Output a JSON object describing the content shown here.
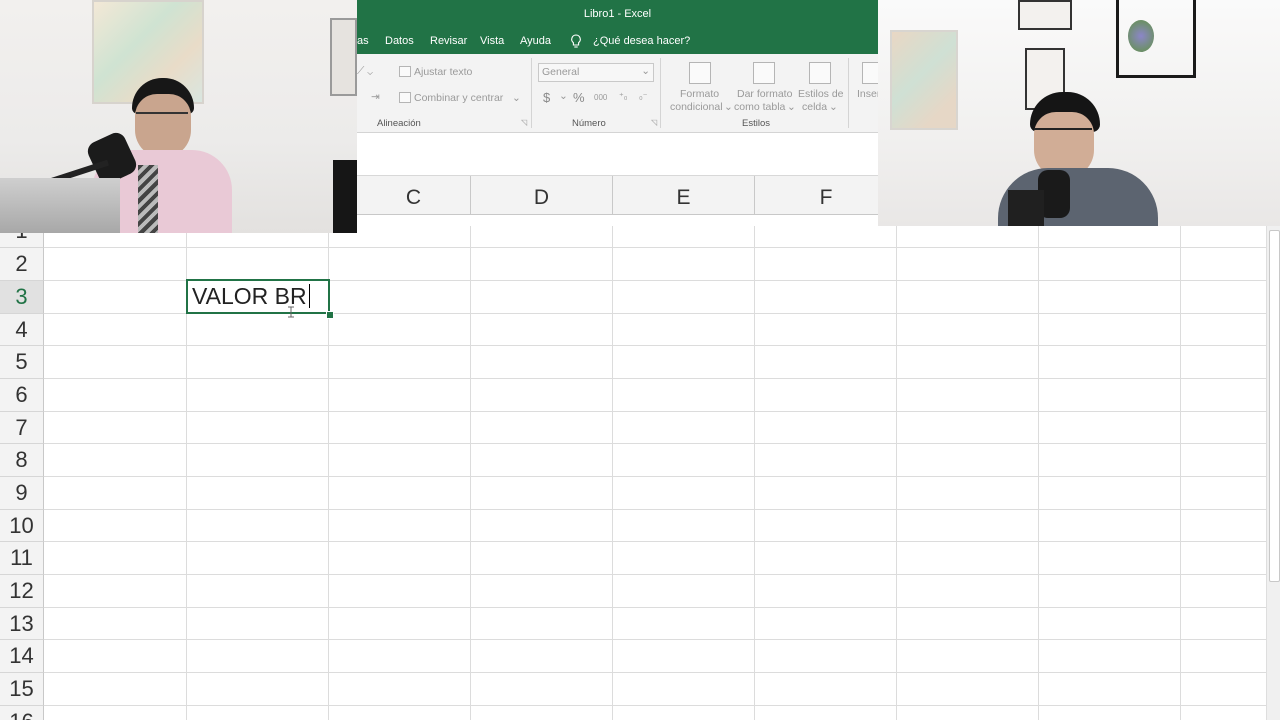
{
  "window": {
    "title": "Libro1  -  Excel"
  },
  "ribbon_tabs": [
    "as",
    "Datos",
    "Revisar",
    "Vista",
    "Ayuda"
  ],
  "tell_me": "¿Qué desea hacer?",
  "ribbon": {
    "wrap_text": "Ajustar texto",
    "merge_center": "Combinar y centrar",
    "number_format": "General",
    "currency": "$",
    "percent": "%",
    "thousands": "000",
    "cond_format_1": "Formato",
    "cond_format_2": "condicional",
    "table_format_1": "Dar formato",
    "table_format_2": "como tabla",
    "cell_styles_1": "Estilos de",
    "cell_styles_2": "celda",
    "insert": "Inser",
    "group_alignment": "Alineación",
    "group_number": "Número",
    "group_styles": "Estilos"
  },
  "columns": [
    "C",
    "D",
    "E",
    "F"
  ],
  "rows": [
    "1",
    "2",
    "3",
    "4",
    "5",
    "6",
    "7",
    "8",
    "9",
    "10",
    "11",
    "12",
    "13",
    "14",
    "15",
    "16"
  ],
  "active_cell": {
    "row": "3",
    "value": "VALOR BR"
  },
  "colors": {
    "excel_green": "#217346"
  }
}
